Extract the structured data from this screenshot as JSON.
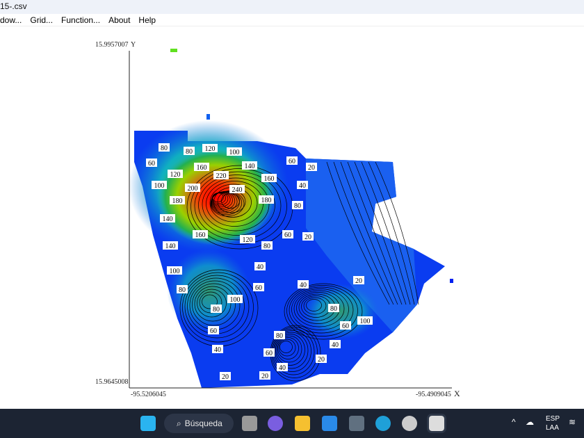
{
  "window": {
    "title": "15-.csv"
  },
  "menu": [
    "dow...",
    "Grid...",
    "Function...",
    "About",
    "Help"
  ],
  "plot": {
    "y_max_label": "15.9957007",
    "y_axis": "Y",
    "y_min_label": "15.9645008",
    "x_min_label": "-95.5206045",
    "x_max_label": "-95.4909045",
    "x_axis": "X",
    "contour_labels": [
      "80",
      "80",
      "120",
      "100",
      "60",
      "160",
      "140",
      "60",
      "20",
      "120",
      "220",
      "160",
      "100",
      "200",
      "240",
      "40",
      "180",
      "180",
      "80",
      "140",
      "160",
      "120",
      "60",
      "20",
      "80",
      "140",
      "40",
      "100",
      "60",
      "40",
      "20",
      "80",
      "100",
      "80",
      "80",
      "60",
      "100",
      "60",
      "80",
      "40",
      "40",
      "60",
      "20",
      "40",
      "20",
      "20"
    ]
  },
  "taskbar": {
    "search": "Búsqueda",
    "lang1": "ESP",
    "lang2": "LAA"
  },
  "colors": {
    "low": "#0a2cf0",
    "mid": "#22b04a",
    "high": "#ff1010",
    "taskbar": "#1c2433"
  }
}
